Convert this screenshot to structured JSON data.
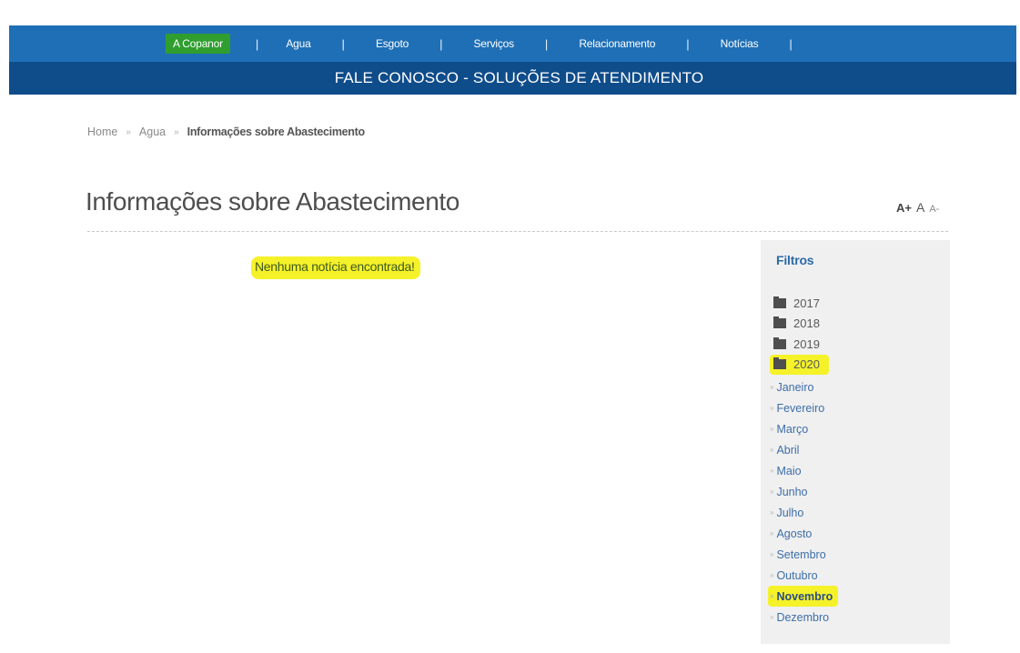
{
  "nav": {
    "items": [
      {
        "label": "A Copanor",
        "active": true
      },
      {
        "label": "Agua",
        "active": false
      },
      {
        "label": "Esgoto",
        "active": false
      },
      {
        "label": "Serviços",
        "active": false
      },
      {
        "label": "Relacionamento",
        "active": false
      },
      {
        "label": "Notícias",
        "active": false
      }
    ],
    "separator": "|"
  },
  "banner": {
    "text": "FALE CONOSCO - SOLUÇÕES DE ATENDIMENTO"
  },
  "breadcrumb": {
    "home": "Home",
    "section": "Agua",
    "current": "Informações sobre Abastecimento",
    "separator": "»"
  },
  "page": {
    "title": "Informações sobre Abastecimento",
    "empty_message": "Nenhuma notícia encontrada!"
  },
  "font_tools": {
    "increase": "A+",
    "normal": "A",
    "decrease": "A-"
  },
  "filters": {
    "title": "Filtros",
    "years": [
      "2017",
      "2018",
      "2019",
      "2020"
    ],
    "selected_year": "2020",
    "months": [
      "Janeiro",
      "Fevereiro",
      "Março",
      "Abril",
      "Maio",
      "Junho",
      "Julho",
      "Agosto",
      "Setembro",
      "Outubro",
      "Novembro",
      "Dezembro"
    ],
    "selected_month": "Novembro",
    "month_bullet": "»"
  },
  "colors": {
    "nav_bg": "#1f6fb6",
    "banner_bg": "#0f4c8a",
    "active_nav": "#2f9e2f",
    "highlight": "#f5f22a",
    "sidebar_bg": "#f0f0f0",
    "link": "#3d6ea8"
  },
  "icons": {
    "year_folder": "folder-icon"
  }
}
